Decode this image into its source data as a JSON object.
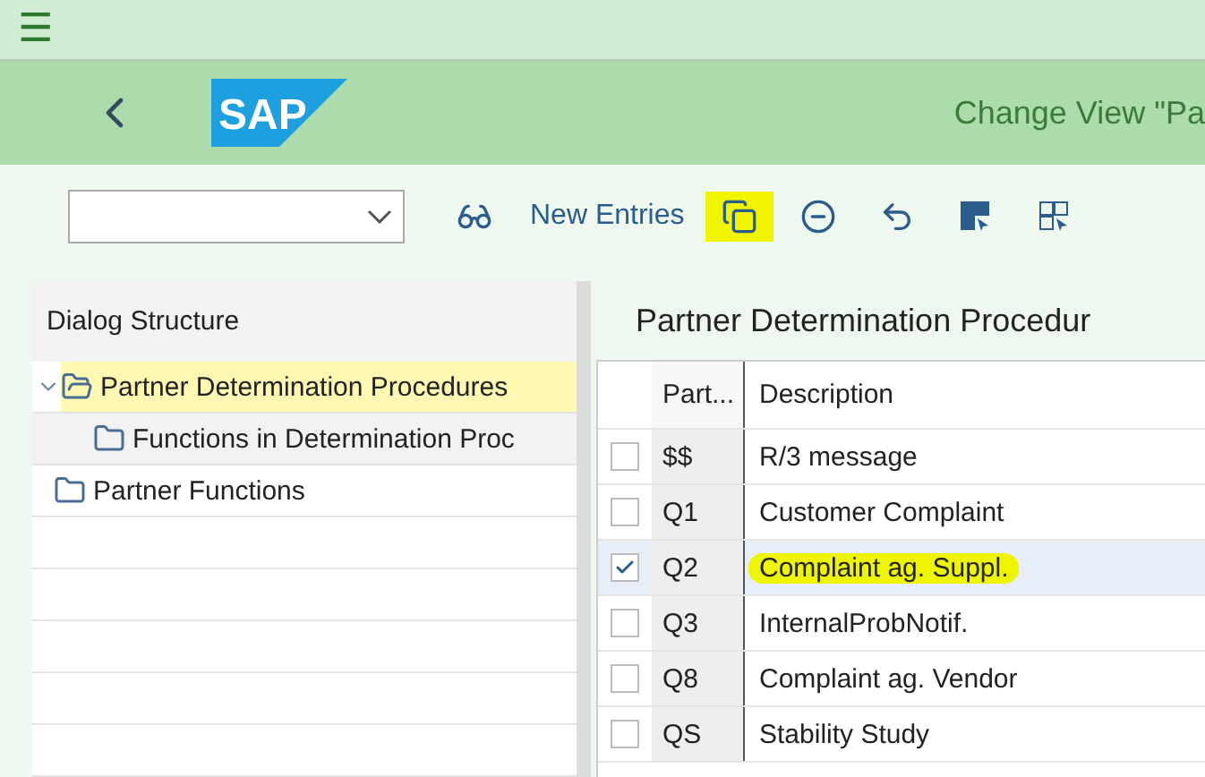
{
  "shell": {
    "menu": "☰"
  },
  "header": {
    "logo": "SAP",
    "title": "Change View \"Pa"
  },
  "toolbar": {
    "buttons": [
      {
        "kind": "icon",
        "highlighted": false
      },
      {
        "kind": "text",
        "label": "New Entries",
        "highlighted": false
      },
      {
        "kind": "icon",
        "highlighted": true
      },
      {
        "kind": "icon",
        "highlighted": false
      },
      {
        "kind": "icon",
        "highlighted": false
      },
      {
        "kind": "icon",
        "highlighted": false
      },
      {
        "kind": "icon",
        "highlighted": false
      }
    ]
  },
  "dialog_structure": {
    "title": "Dialog Structure",
    "items": [
      {
        "label": "Partner Determination Procedures",
        "expanded": true,
        "selected": true,
        "children": [
          {
            "label": "Functions in Determination Proc",
            "selected": false
          }
        ]
      },
      {
        "label": "Partner Functions",
        "expanded": false,
        "selected": false
      }
    ]
  },
  "table": {
    "title": "Partner Determination Procedur",
    "columns": [
      "Part...",
      "Description"
    ],
    "rows": [
      {
        "key": "$$",
        "description": "R/3 message",
        "checked": false,
        "highlighted": false
      },
      {
        "key": "Q1",
        "description": "Customer Complaint",
        "checked": false,
        "highlighted": false
      },
      {
        "key": "Q2",
        "description": "Complaint ag. Suppl.",
        "checked": true,
        "highlighted": true
      },
      {
        "key": "Q3",
        "description": "InternalProbNotif.",
        "checked": false,
        "highlighted": false
      },
      {
        "key": "Q8",
        "description": "Complaint ag. Vendor",
        "checked": false,
        "highlighted": false
      },
      {
        "key": "QS",
        "description": "Stability Study",
        "checked": false,
        "highlighted": false
      }
    ]
  }
}
